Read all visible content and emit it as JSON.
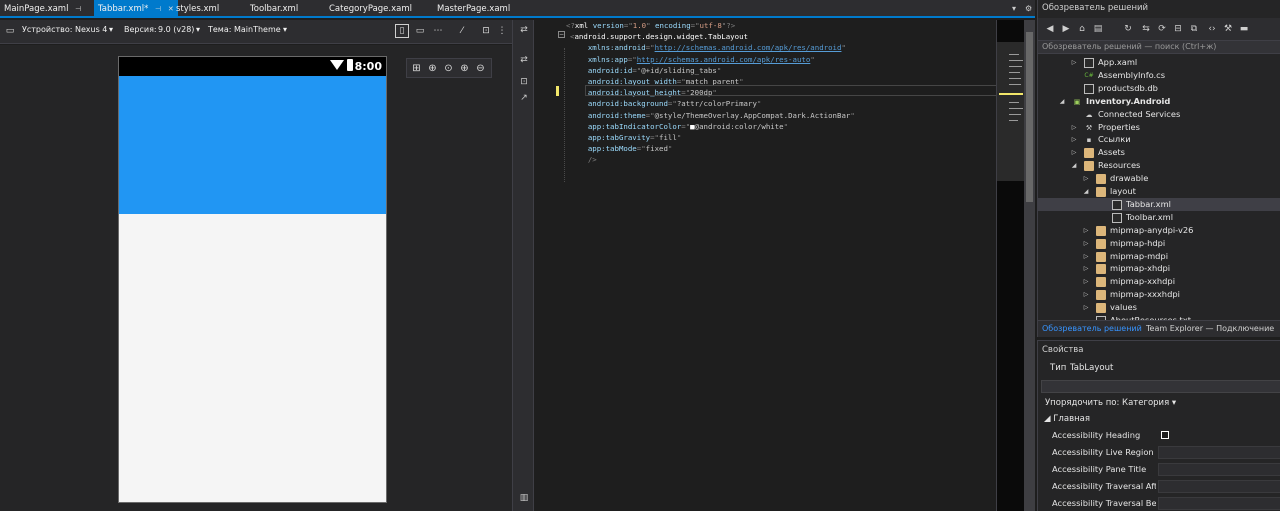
{
  "tabs": [
    {
      "label": "MainPage.xaml",
      "pin": "⊣"
    },
    {
      "label": "Tabbar.xml*",
      "pin": "⊣",
      "close": "✕",
      "active": true
    },
    {
      "label": "styles.xml"
    },
    {
      "label": "Toolbar.xml"
    },
    {
      "label": "CategoryPage.xaml"
    },
    {
      "label": "MasterPage.xaml"
    }
  ],
  "designer_toolbar": {
    "device_label": "Устройство:",
    "device_value": "Nexus 4",
    "version_label": "Версия:",
    "version_value": "9.0 (v28)",
    "theme_label": "Тема:",
    "theme_value": "MainTheme"
  },
  "status_bar": {
    "time": "8:00"
  },
  "code_lines": [
    [
      {
        "t": "punct",
        "v": "<?"
      },
      {
        "t": "tag",
        "v": "xml"
      },
      {
        "t": "attr",
        "v": " version"
      },
      {
        "t": "punct",
        "v": "=\""
      },
      {
        "t": "str",
        "v": "1.0"
      },
      {
        "t": "punct",
        "v": "\""
      },
      {
        "t": "attr",
        "v": " encoding"
      },
      {
        "t": "punct",
        "v": "=\""
      },
      {
        "t": "str",
        "v": "utf-8"
      },
      {
        "t": "punct",
        "v": "\"?>"
      }
    ],
    [
      {
        "t": "punct",
        "v": "<"
      },
      {
        "t": "tag",
        "v": "android.support.design.widget.TabLayout"
      }
    ],
    [
      {
        "t": "val",
        "v": "    "
      },
      {
        "t": "attr",
        "v": "xmlns:android"
      },
      {
        "t": "punct",
        "v": "=\""
      },
      {
        "t": "link",
        "v": "http://schemas.android.com/apk/res/android"
      },
      {
        "t": "punct",
        "v": "\""
      }
    ],
    [
      {
        "t": "val",
        "v": "    "
      },
      {
        "t": "attr",
        "v": "xmlns:app"
      },
      {
        "t": "punct",
        "v": "=\""
      },
      {
        "t": "link",
        "v": "http://schemas.android.com/apk/res-auto"
      },
      {
        "t": "punct",
        "v": "\""
      }
    ],
    [
      {
        "t": "val",
        "v": "    "
      },
      {
        "t": "attr",
        "v": "android:id"
      },
      {
        "t": "punct",
        "v": "=\""
      },
      {
        "t": "val",
        "v": "@+id/sliding_tabs"
      },
      {
        "t": "punct",
        "v": "\""
      }
    ],
    [
      {
        "t": "val",
        "v": "    "
      },
      {
        "t": "attr",
        "v": "android:layout_width"
      },
      {
        "t": "punct",
        "v": "=\""
      },
      {
        "t": "val",
        "v": "match_parent"
      },
      {
        "t": "punct",
        "v": "\""
      }
    ],
    [
      {
        "t": "val",
        "v": "    "
      },
      {
        "t": "attr",
        "v": "android:layout_height"
      },
      {
        "t": "punct",
        "v": "=\""
      },
      {
        "t": "val",
        "v": "200dp"
      },
      {
        "t": "punct",
        "v": "\""
      }
    ],
    [
      {
        "t": "val",
        "v": "    "
      },
      {
        "t": "attr",
        "v": "android:background"
      },
      {
        "t": "punct",
        "v": "=\""
      },
      {
        "t": "val",
        "v": "?attr/colorPrimary"
      },
      {
        "t": "punct",
        "v": "\""
      }
    ],
    [
      {
        "t": "val",
        "v": "    "
      },
      {
        "t": "attr",
        "v": "android:theme"
      },
      {
        "t": "punct",
        "v": "=\""
      },
      {
        "t": "val",
        "v": "@style/ThemeOverlay.AppCompat.Dark.ActionBar"
      },
      {
        "t": "punct",
        "v": "\""
      }
    ],
    [
      {
        "t": "val",
        "v": "    "
      },
      {
        "t": "attr",
        "v": "app:tabIndicatorColor"
      },
      {
        "t": "punct",
        "v": "=\""
      },
      {
        "t": "tag",
        "v": "■"
      },
      {
        "t": "val",
        "v": "@android:color/white"
      },
      {
        "t": "punct",
        "v": "\""
      }
    ],
    [
      {
        "t": "val",
        "v": "    "
      },
      {
        "t": "attr",
        "v": "app:tabGravity"
      },
      {
        "t": "punct",
        "v": "=\""
      },
      {
        "t": "val",
        "v": "fill"
      },
      {
        "t": "punct",
        "v": "\""
      }
    ],
    [
      {
        "t": "val",
        "v": "    "
      },
      {
        "t": "attr",
        "v": "app:tabMode"
      },
      {
        "t": "punct",
        "v": "=\""
      },
      {
        "t": "val",
        "v": "fixed"
      },
      {
        "t": "punct",
        "v": "\""
      }
    ],
    [
      {
        "t": "val",
        "v": "    "
      },
      {
        "t": "punct",
        "v": "/>"
      }
    ]
  ],
  "solution_explorer": {
    "title": "Обозреватель решений",
    "search_placeholder": "Обозреватель решений — поиск (Ctrl+ж)",
    "items": [
      {
        "label": "App.xaml",
        "arrow": "▷",
        "icon": "file",
        "depth": 1
      },
      {
        "label": "AssemblyInfo.cs",
        "arrow": "",
        "icon": "cs",
        "depth": 1
      },
      {
        "label": "productsdb.db",
        "arrow": "",
        "icon": "file",
        "depth": 1
      },
      {
        "label": "Inventory.Android",
        "arrow": "◢",
        "icon": "project",
        "depth": 0,
        "bold": true
      },
      {
        "label": "Connected Services",
        "arrow": "",
        "icon": "cloud",
        "depth": 1
      },
      {
        "label": "Properties",
        "arrow": "▷",
        "icon": "wrench",
        "depth": 1
      },
      {
        "label": "Ссылки",
        "arrow": "▷",
        "icon": "refs",
        "depth": 1
      },
      {
        "label": "Assets",
        "arrow": "▷",
        "icon": "folder",
        "depth": 1
      },
      {
        "label": "Resources",
        "arrow": "◢",
        "icon": "folder",
        "depth": 1
      },
      {
        "label": "drawable",
        "arrow": "▷",
        "icon": "folder",
        "depth": 2
      },
      {
        "label": "layout",
        "arrow": "◢",
        "icon": "folder",
        "depth": 2
      },
      {
        "label": "Tabbar.xml",
        "arrow": "",
        "icon": "file",
        "depth": 3,
        "selected": true
      },
      {
        "label": "Toolbar.xml",
        "arrow": "",
        "icon": "file",
        "depth": 3
      },
      {
        "label": "mipmap-anydpi-v26",
        "arrow": "▷",
        "icon": "folder",
        "depth": 2
      },
      {
        "label": "mipmap-hdpi",
        "arrow": "▷",
        "icon": "folder",
        "depth": 2
      },
      {
        "label": "mipmap-mdpi",
        "arrow": "▷",
        "icon": "folder",
        "depth": 2
      },
      {
        "label": "mipmap-xhdpi",
        "arrow": "▷",
        "icon": "folder",
        "depth": 2
      },
      {
        "label": "mipmap-xxhdpi",
        "arrow": "▷",
        "icon": "folder",
        "depth": 2
      },
      {
        "label": "mipmap-xxxhdpi",
        "arrow": "▷",
        "icon": "folder",
        "depth": 2
      },
      {
        "label": "values",
        "arrow": "▷",
        "icon": "folder",
        "depth": 2
      },
      {
        "label": "AboutResources.txt",
        "arrow": "",
        "icon": "file",
        "depth": 2
      }
    ],
    "bottom_tabs": [
      "Обозреватель решений",
      "Team Explorer — Подключение"
    ]
  },
  "properties": {
    "title": "Свойства",
    "type_label": "Тип",
    "type_value": "TabLayout",
    "sort_label": "Упорядочить по: Категория",
    "group_label": "Главная",
    "rows": [
      {
        "name": "Accessibility Heading",
        "checkbox": true
      },
      {
        "name": "Accessibility Live Region"
      },
      {
        "name": "Accessibility Pane Title"
      },
      {
        "name": "Accessibility Traversal After"
      },
      {
        "name": "Accessibility Traversal Bef..."
      }
    ]
  },
  "colors": {
    "accent": "#007acc",
    "tab_preview": "#2196f3",
    "editor_bg": "#1e1e1e"
  }
}
